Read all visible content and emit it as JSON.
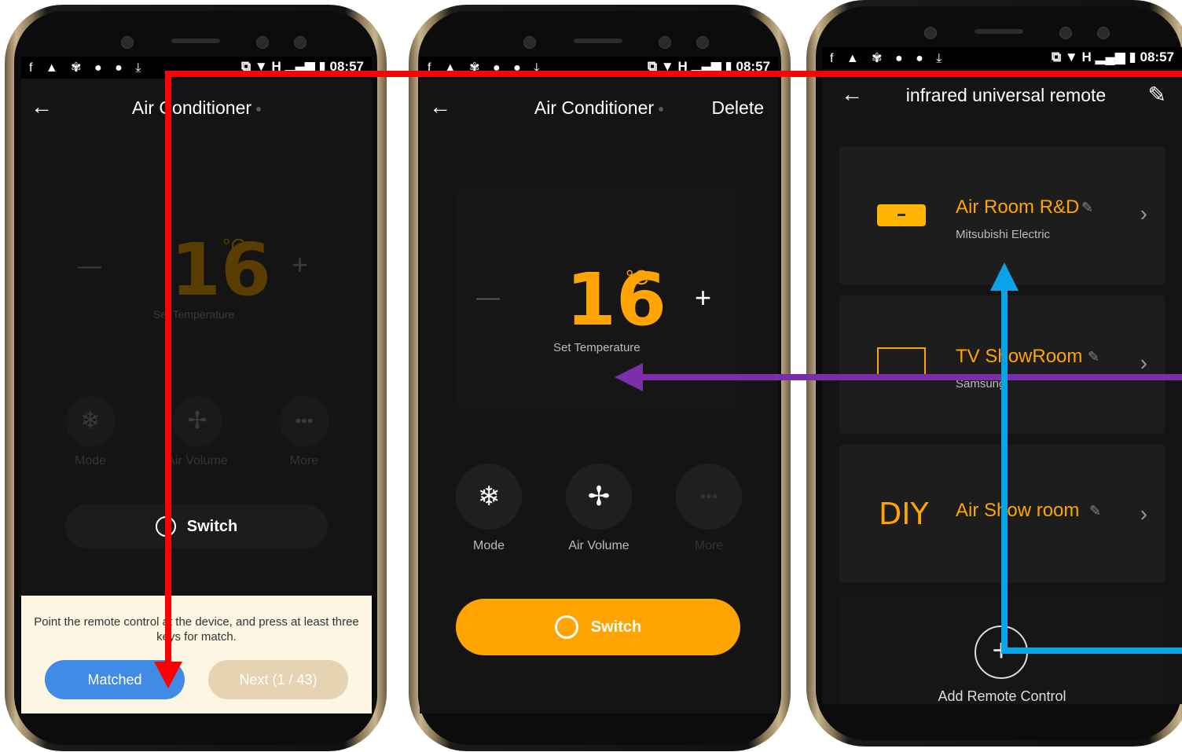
{
  "status": {
    "time": "08:57",
    "network": "H"
  },
  "screen1": {
    "title": "Air Conditioner",
    "temperature": "16",
    "unit": "°C",
    "temp_label": "Set Temperature",
    "minus": "—",
    "plus": "+",
    "modes": [
      {
        "label": "Mode",
        "icon": "snowflake-icon"
      },
      {
        "label": "Air Volume",
        "icon": "fan-icon"
      },
      {
        "label": "More",
        "icon": "more-dots-icon"
      }
    ],
    "switch_label": "Switch",
    "match_instruction": "Point the remote control at the device, and press at least three keys for match.",
    "matched_label": "Matched",
    "next_label": "Next (1 / 43)"
  },
  "screen2": {
    "title": "Air Conditioner",
    "delete_label": "Delete",
    "temperature": "16",
    "unit": "°C",
    "temp_label": "Set Temperature",
    "minus": "—",
    "plus": "+",
    "modes": [
      {
        "label": "Mode",
        "icon": "snowflake-icon"
      },
      {
        "label": "Air Volume",
        "icon": "fan-icon"
      },
      {
        "label": "More",
        "icon": "more-dots-icon"
      }
    ],
    "switch_label": "Switch"
  },
  "screen3": {
    "title": "infrared universal remote",
    "devices": [
      {
        "name": "Air Room R&D",
        "brand": "Mitsubishi Electric",
        "icon": "air-conditioner-icon"
      },
      {
        "name": "TV ShowRoom",
        "brand": "Samsung",
        "icon": "tv-icon"
      },
      {
        "name": "Air Show room",
        "brand": "",
        "icon": "diy-icon",
        "icon_text": "DIY"
      }
    ],
    "add_label": "Add Remote Control"
  },
  "annotations": {
    "red_arrow": "#ff0000",
    "purple_arrow": "#7a2fa8",
    "blue_arrow": "#0aa3e8"
  },
  "colors": {
    "accent": "#ffa400",
    "matched_button": "#3f8be6",
    "next_button": "#e5d3b1",
    "match_panel": "#fcf6e3"
  }
}
